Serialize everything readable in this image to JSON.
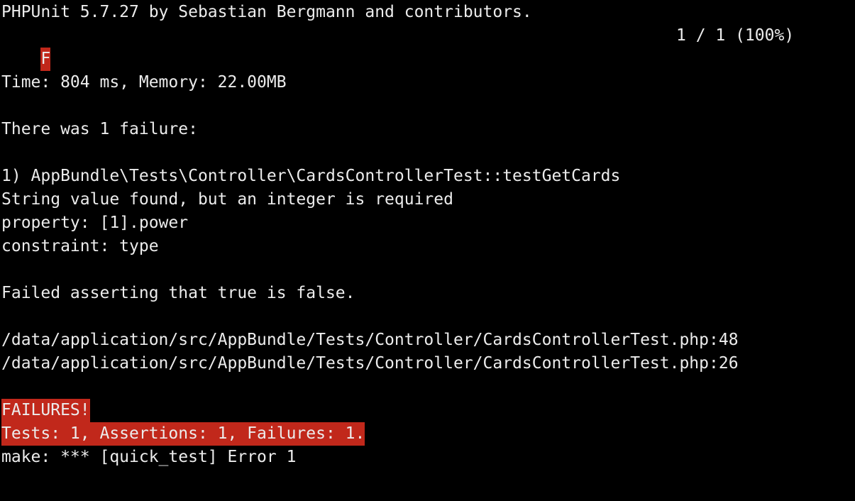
{
  "terminal": {
    "header": "PHPUnit 5.7.27 by Sebastian Bergmann and contributors.",
    "status_char": "F",
    "progress": "1 / 1 (100%)",
    "time_memory": "Time: 804 ms, Memory: 22.00MB",
    "failure_count": "There was 1 failure:",
    "failure_title": "1) AppBundle\\Tests\\Controller\\CardsControllerTest::testGetCards",
    "failure_message": "String value found, but an integer is required",
    "failure_property": "property: [1].power",
    "failure_constraint": "constraint: type",
    "assertion": "Failed asserting that true is false.",
    "trace": [
      "/data/application/src/AppBundle/Tests/Controller/CardsControllerTest.php:48",
      "/data/application/src/AppBundle/Tests/Controller/CardsControllerTest.php:26"
    ],
    "failures_banner": "FAILURES!",
    "summary": "Tests: 1, Assertions: 1, Failures: 1.",
    "make_error": "make: *** [quick_test] Error 1"
  },
  "colors": {
    "background": "#000000",
    "text": "#ececec",
    "failure_highlight": "#c1281b"
  }
}
